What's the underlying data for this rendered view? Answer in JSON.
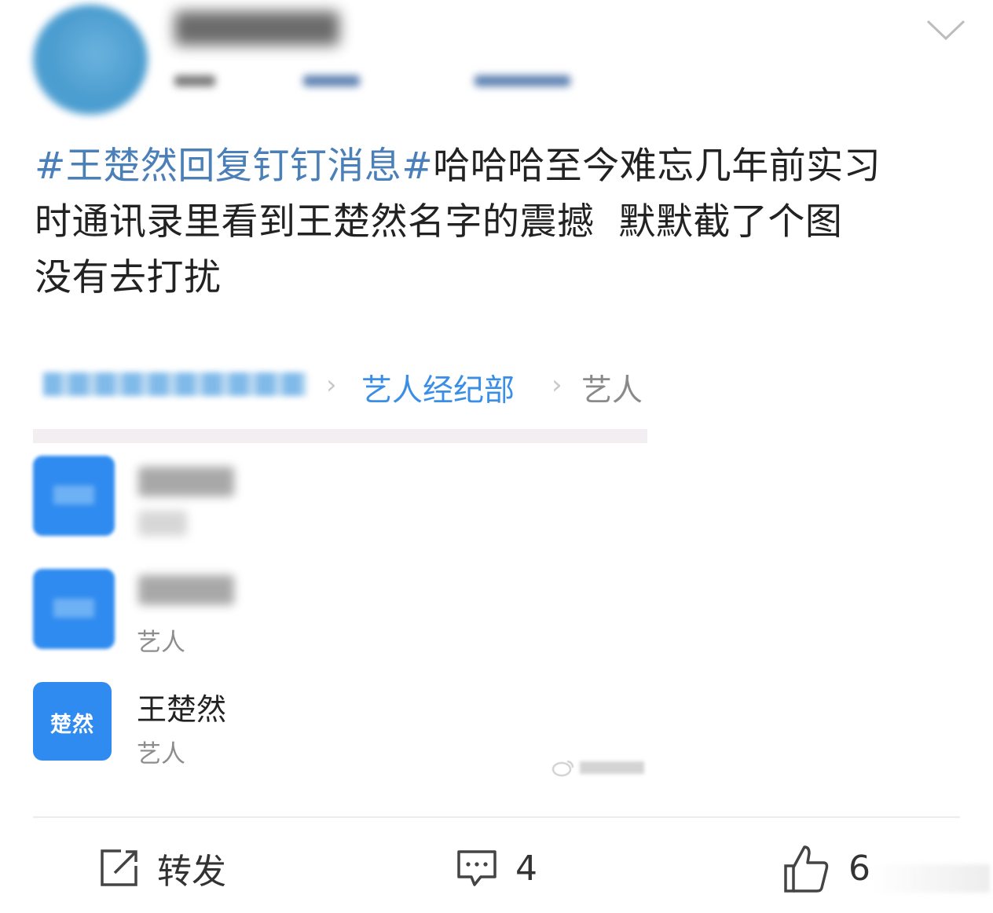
{
  "post": {
    "topic": "#王楚然回复钉钉消息#",
    "line1_rest": "哈哈哈至今难忘几年前实习",
    "line2": "时通讯录里看到王楚然名字的震撼  默默截了个图",
    "line3": "没有去打扰"
  },
  "screenshot": {
    "breadcrumb": {
      "arrow_1": "›",
      "department": "艺人经纪部",
      "arrow_2": "›",
      "current": "艺人"
    },
    "contacts": [
      {
        "role": "艺人"
      },
      {
        "name": "王楚然",
        "role": "艺人",
        "avatar_text": "楚然"
      }
    ]
  },
  "actions": {
    "repost_label": "转发",
    "comment_count": "4",
    "like_count": "6"
  },
  "colors": {
    "topic": "#4a7fb8",
    "accent_blue": "#2f8bef",
    "breadcrumb_blue": "#3a8ee6"
  }
}
